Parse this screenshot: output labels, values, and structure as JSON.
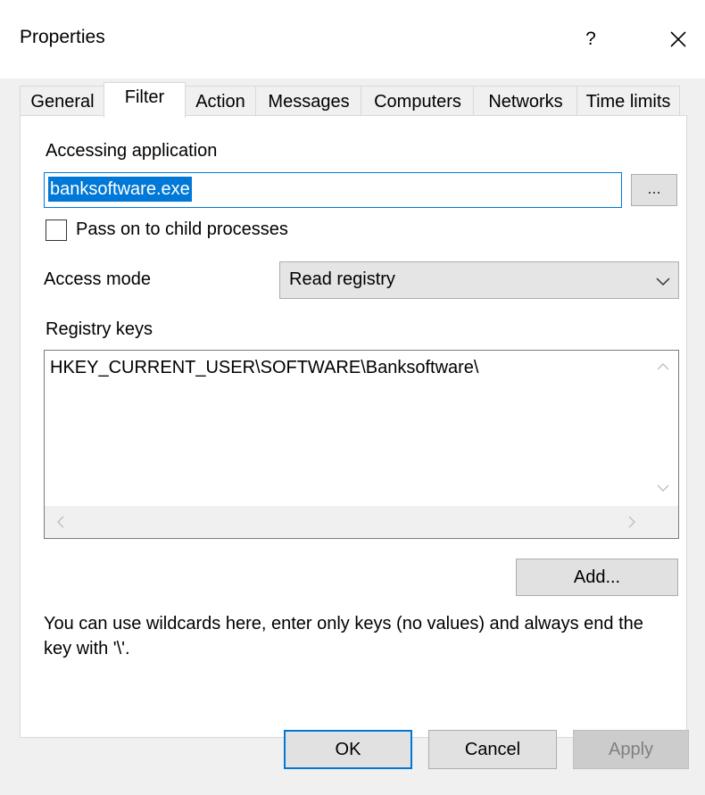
{
  "window": {
    "title": "Properties",
    "help_label": "?",
    "close_icon": "close-icon"
  },
  "tabs": [
    {
      "label": "General",
      "active": false
    },
    {
      "label": "Filter",
      "active": true
    },
    {
      "label": "Action",
      "active": false
    },
    {
      "label": "Messages",
      "active": false
    },
    {
      "label": "Computers",
      "active": false
    },
    {
      "label": "Networks",
      "active": false
    },
    {
      "label": "Time limits",
      "active": false
    }
  ],
  "filter": {
    "accessing_application_label": "Accessing application",
    "accessing_application_value": "banksoftware.exe",
    "browse_label": "...",
    "pass_to_child_label": "Pass on to child processes",
    "pass_to_child_checked": false,
    "access_mode_label": "Access mode",
    "access_mode_value": "Read registry",
    "registry_keys_label": "Registry keys",
    "registry_keys": [
      "HKEY_CURRENT_USER\\SOFTWARE\\Banksoftware\\"
    ],
    "add_label": "Add...",
    "hint": "You can use wildcards here, enter only keys (no values) and always end the key with '\\'."
  },
  "buttons": {
    "ok": "OK",
    "cancel": "Cancel",
    "apply": "Apply"
  },
  "colors": {
    "accent": "#0078d7",
    "dialog_bg": "#f0f0f0"
  }
}
